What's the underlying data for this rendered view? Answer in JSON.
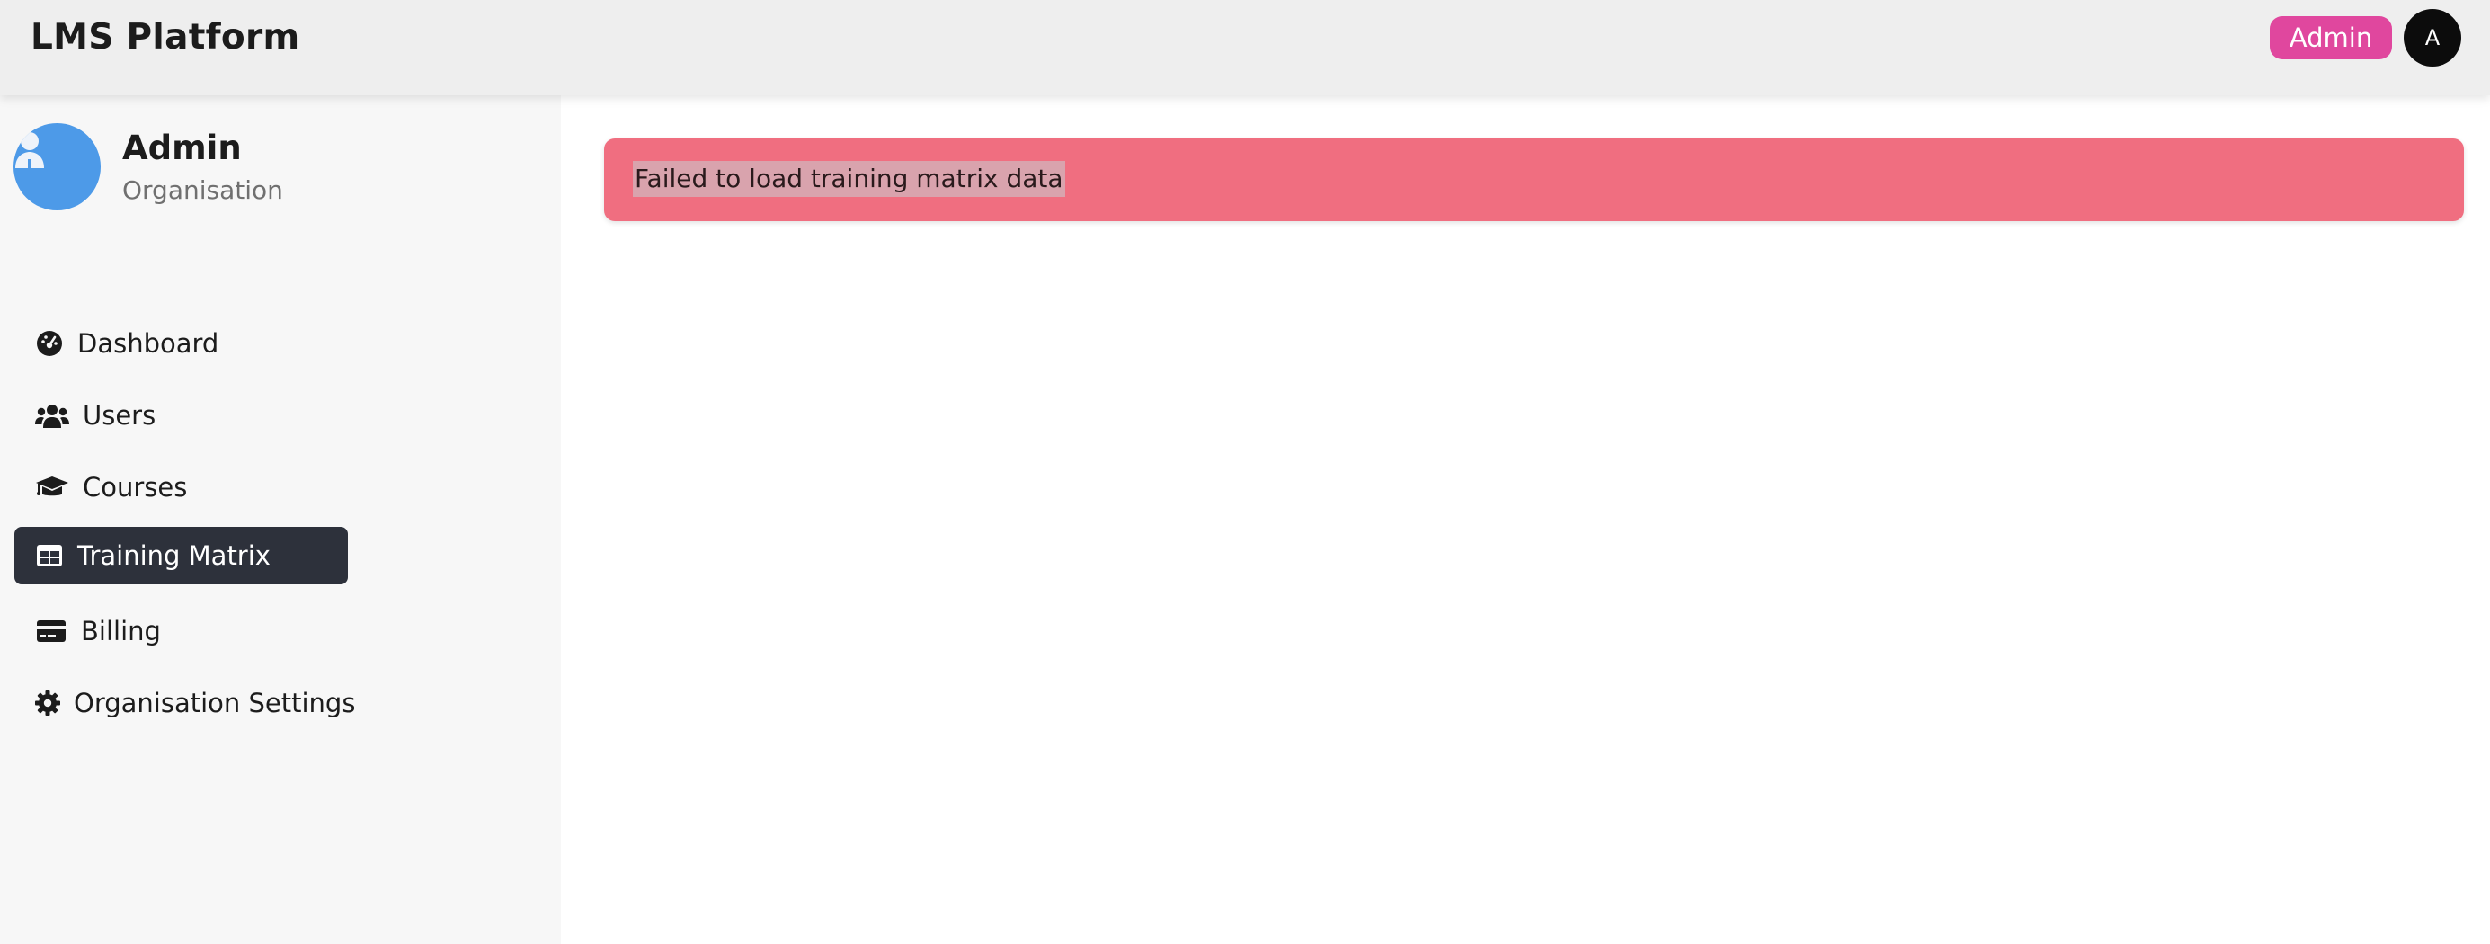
{
  "header": {
    "app_title": "LMS Platform",
    "role_badge": "Admin",
    "avatar_initial": "A",
    "role_badge_color": "#e0479e"
  },
  "sidebar": {
    "profile": {
      "name": "Admin",
      "role": "Organisation",
      "avatar_color": "#4d9ae8"
    },
    "items": [
      {
        "label": "Dashboard",
        "icon": "dashboard-gauge-icon",
        "active": false
      },
      {
        "label": "Users",
        "icon": "users-icon",
        "active": false
      },
      {
        "label": "Courses",
        "icon": "graduation-cap-icon",
        "active": false
      },
      {
        "label": "Training Matrix",
        "icon": "table-icon",
        "active": true
      },
      {
        "label": "Billing",
        "icon": "credit-card-icon",
        "active": false
      },
      {
        "label": "Organisation Settings",
        "icon": "gear-icon",
        "active": false
      }
    ]
  },
  "main": {
    "alert": {
      "type": "error",
      "message": "Failed to load training matrix data",
      "color": "#f06e80"
    }
  }
}
